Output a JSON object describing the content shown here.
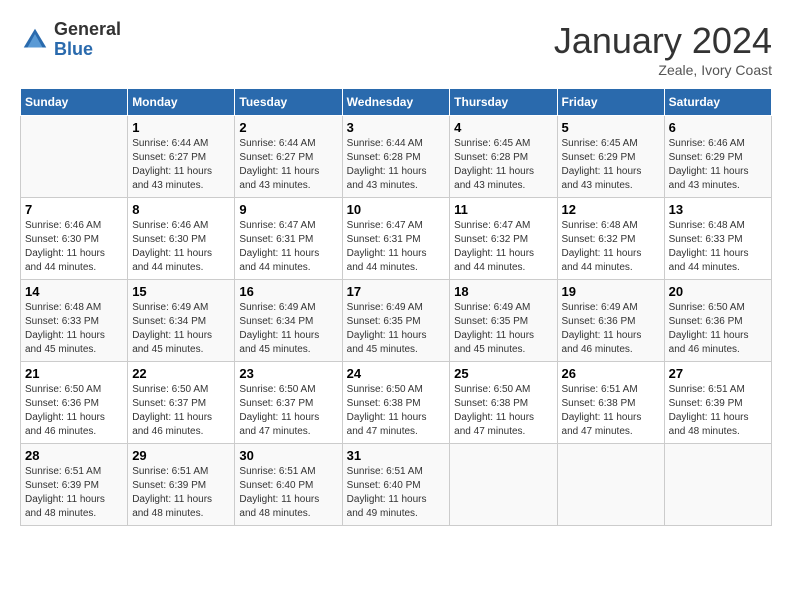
{
  "header": {
    "logo_general": "General",
    "logo_blue": "Blue",
    "month_title": "January 2024",
    "location": "Zeale, Ivory Coast"
  },
  "days_of_week": [
    "Sunday",
    "Monday",
    "Tuesday",
    "Wednesday",
    "Thursday",
    "Friday",
    "Saturday"
  ],
  "weeks": [
    [
      {
        "day": "",
        "sunrise": "",
        "sunset": "",
        "daylight": ""
      },
      {
        "day": "1",
        "sunrise": "Sunrise: 6:44 AM",
        "sunset": "Sunset: 6:27 PM",
        "daylight": "Daylight: 11 hours and 43 minutes."
      },
      {
        "day": "2",
        "sunrise": "Sunrise: 6:44 AM",
        "sunset": "Sunset: 6:27 PM",
        "daylight": "Daylight: 11 hours and 43 minutes."
      },
      {
        "day": "3",
        "sunrise": "Sunrise: 6:44 AM",
        "sunset": "Sunset: 6:28 PM",
        "daylight": "Daylight: 11 hours and 43 minutes."
      },
      {
        "day": "4",
        "sunrise": "Sunrise: 6:45 AM",
        "sunset": "Sunset: 6:28 PM",
        "daylight": "Daylight: 11 hours and 43 minutes."
      },
      {
        "day": "5",
        "sunrise": "Sunrise: 6:45 AM",
        "sunset": "Sunset: 6:29 PM",
        "daylight": "Daylight: 11 hours and 43 minutes."
      },
      {
        "day": "6",
        "sunrise": "Sunrise: 6:46 AM",
        "sunset": "Sunset: 6:29 PM",
        "daylight": "Daylight: 11 hours and 43 minutes."
      }
    ],
    [
      {
        "day": "7",
        "sunrise": "Sunrise: 6:46 AM",
        "sunset": "Sunset: 6:30 PM",
        "daylight": "Daylight: 11 hours and 44 minutes."
      },
      {
        "day": "8",
        "sunrise": "Sunrise: 6:46 AM",
        "sunset": "Sunset: 6:30 PM",
        "daylight": "Daylight: 11 hours and 44 minutes."
      },
      {
        "day": "9",
        "sunrise": "Sunrise: 6:47 AM",
        "sunset": "Sunset: 6:31 PM",
        "daylight": "Daylight: 11 hours and 44 minutes."
      },
      {
        "day": "10",
        "sunrise": "Sunrise: 6:47 AM",
        "sunset": "Sunset: 6:31 PM",
        "daylight": "Daylight: 11 hours and 44 minutes."
      },
      {
        "day": "11",
        "sunrise": "Sunrise: 6:47 AM",
        "sunset": "Sunset: 6:32 PM",
        "daylight": "Daylight: 11 hours and 44 minutes."
      },
      {
        "day": "12",
        "sunrise": "Sunrise: 6:48 AM",
        "sunset": "Sunset: 6:32 PM",
        "daylight": "Daylight: 11 hours and 44 minutes."
      },
      {
        "day": "13",
        "sunrise": "Sunrise: 6:48 AM",
        "sunset": "Sunset: 6:33 PM",
        "daylight": "Daylight: 11 hours and 44 minutes."
      }
    ],
    [
      {
        "day": "14",
        "sunrise": "Sunrise: 6:48 AM",
        "sunset": "Sunset: 6:33 PM",
        "daylight": "Daylight: 11 hours and 45 minutes."
      },
      {
        "day": "15",
        "sunrise": "Sunrise: 6:49 AM",
        "sunset": "Sunset: 6:34 PM",
        "daylight": "Daylight: 11 hours and 45 minutes."
      },
      {
        "day": "16",
        "sunrise": "Sunrise: 6:49 AM",
        "sunset": "Sunset: 6:34 PM",
        "daylight": "Daylight: 11 hours and 45 minutes."
      },
      {
        "day": "17",
        "sunrise": "Sunrise: 6:49 AM",
        "sunset": "Sunset: 6:35 PM",
        "daylight": "Daylight: 11 hours and 45 minutes."
      },
      {
        "day": "18",
        "sunrise": "Sunrise: 6:49 AM",
        "sunset": "Sunset: 6:35 PM",
        "daylight": "Daylight: 11 hours and 45 minutes."
      },
      {
        "day": "19",
        "sunrise": "Sunrise: 6:49 AM",
        "sunset": "Sunset: 6:36 PM",
        "daylight": "Daylight: 11 hours and 46 minutes."
      },
      {
        "day": "20",
        "sunrise": "Sunrise: 6:50 AM",
        "sunset": "Sunset: 6:36 PM",
        "daylight": "Daylight: 11 hours and 46 minutes."
      }
    ],
    [
      {
        "day": "21",
        "sunrise": "Sunrise: 6:50 AM",
        "sunset": "Sunset: 6:36 PM",
        "daylight": "Daylight: 11 hours and 46 minutes."
      },
      {
        "day": "22",
        "sunrise": "Sunrise: 6:50 AM",
        "sunset": "Sunset: 6:37 PM",
        "daylight": "Daylight: 11 hours and 46 minutes."
      },
      {
        "day": "23",
        "sunrise": "Sunrise: 6:50 AM",
        "sunset": "Sunset: 6:37 PM",
        "daylight": "Daylight: 11 hours and 47 minutes."
      },
      {
        "day": "24",
        "sunrise": "Sunrise: 6:50 AM",
        "sunset": "Sunset: 6:38 PM",
        "daylight": "Daylight: 11 hours and 47 minutes."
      },
      {
        "day": "25",
        "sunrise": "Sunrise: 6:50 AM",
        "sunset": "Sunset: 6:38 PM",
        "daylight": "Daylight: 11 hours and 47 minutes."
      },
      {
        "day": "26",
        "sunrise": "Sunrise: 6:51 AM",
        "sunset": "Sunset: 6:38 PM",
        "daylight": "Daylight: 11 hours and 47 minutes."
      },
      {
        "day": "27",
        "sunrise": "Sunrise: 6:51 AM",
        "sunset": "Sunset: 6:39 PM",
        "daylight": "Daylight: 11 hours and 48 minutes."
      }
    ],
    [
      {
        "day": "28",
        "sunrise": "Sunrise: 6:51 AM",
        "sunset": "Sunset: 6:39 PM",
        "daylight": "Daylight: 11 hours and 48 minutes."
      },
      {
        "day": "29",
        "sunrise": "Sunrise: 6:51 AM",
        "sunset": "Sunset: 6:39 PM",
        "daylight": "Daylight: 11 hours and 48 minutes."
      },
      {
        "day": "30",
        "sunrise": "Sunrise: 6:51 AM",
        "sunset": "Sunset: 6:40 PM",
        "daylight": "Daylight: 11 hours and 48 minutes."
      },
      {
        "day": "31",
        "sunrise": "Sunrise: 6:51 AM",
        "sunset": "Sunset: 6:40 PM",
        "daylight": "Daylight: 11 hours and 49 minutes."
      },
      {
        "day": "",
        "sunrise": "",
        "sunset": "",
        "daylight": ""
      },
      {
        "day": "",
        "sunrise": "",
        "sunset": "",
        "daylight": ""
      },
      {
        "day": "",
        "sunrise": "",
        "sunset": "",
        "daylight": ""
      }
    ]
  ]
}
